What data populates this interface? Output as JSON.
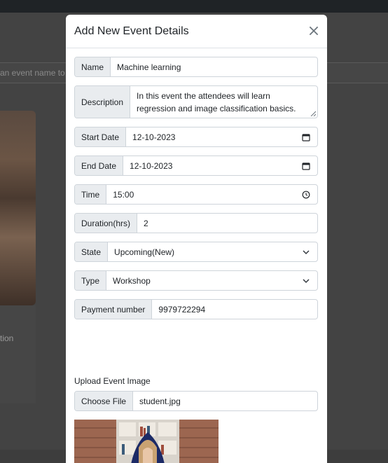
{
  "background": {
    "search_placeholder_fragment": "an event name to s",
    "card_text_fragment": "tion"
  },
  "modal": {
    "title": "Add New Event Details",
    "close_icon": "close-icon",
    "fields": {
      "name": {
        "label": "Name",
        "value": "Machine learning"
      },
      "description": {
        "label": "Description",
        "value": "In this event the attendees will learn regression and image classification basics."
      },
      "start_date": {
        "label": "Start Date",
        "value": "12-10-2023",
        "icon": "calendar-icon"
      },
      "end_date": {
        "label": "End Date",
        "value": "12-10-2023",
        "icon": "calendar-icon"
      },
      "time": {
        "label": "Time",
        "value": "15:00",
        "icon": "clock-icon"
      },
      "duration": {
        "label": "Duration(hrs)",
        "value": "2"
      },
      "state": {
        "label": "State",
        "value": "Upcoming(New)",
        "icon": "chevron-down-icon"
      },
      "type": {
        "label": "Type",
        "value": "Workshop",
        "icon": "chevron-down-icon"
      },
      "payment": {
        "label": "Payment number",
        "value": "9979722294"
      }
    },
    "upload": {
      "label": "Upload Event Image",
      "button": "Choose File",
      "filename": "student.jpg"
    }
  },
  "colors": {
    "overlay": "#434343",
    "label_bg": "#e9ecef",
    "border": "#ced4da"
  }
}
